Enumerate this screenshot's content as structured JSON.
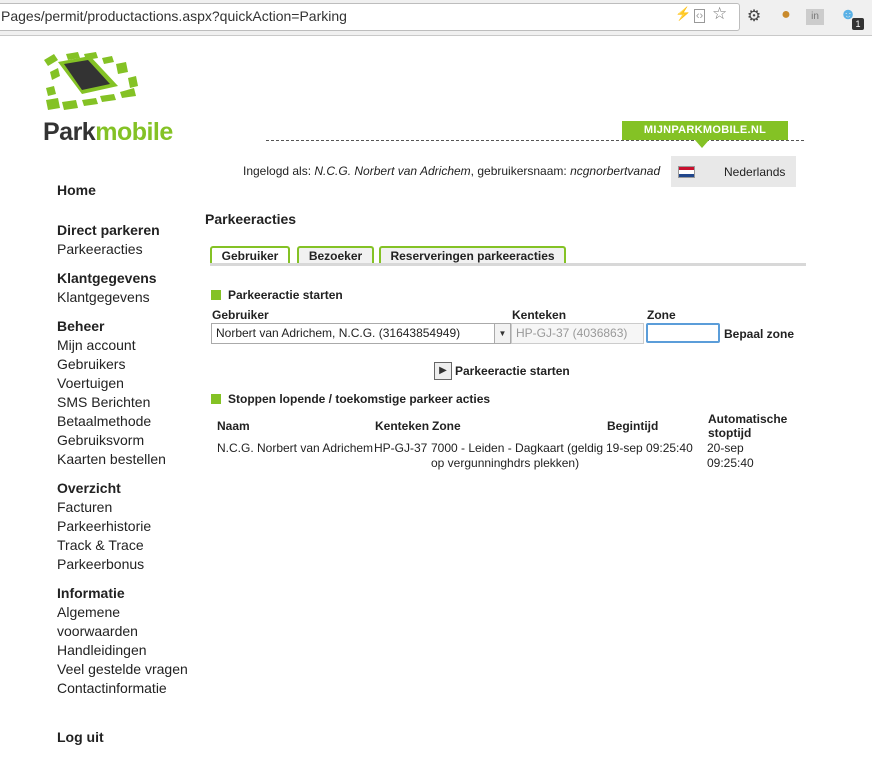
{
  "browser": {
    "url": "Pages/permit/productactions.aspx?quickAction=Parking",
    "badge": "1"
  },
  "header": {
    "brand_dark": "Park",
    "brand_green": "mobile",
    "portal_tab": "MIJNPARKMOBILE.NL",
    "logged_prefix": "Ingelogd als: ",
    "logged_name": "N.C.G. Norbert van Adrichem",
    "logged_mid": ", gebruikersnaam: ",
    "logged_user": "ncgnorbertvanad",
    "language": "Nederlands"
  },
  "nav": {
    "home": "Home",
    "sections": [
      {
        "title": "Direct parkeren",
        "items": [
          "Parkeeracties"
        ]
      },
      {
        "title": "Klantgegevens",
        "items": [
          "Klantgegevens"
        ]
      },
      {
        "title": "Beheer",
        "items": [
          "Mijn account",
          "Gebruikers",
          "Voertuigen",
          "SMS Berichten",
          "Betaalmethode",
          "Gebruiksvorm",
          "Kaarten bestellen"
        ]
      },
      {
        "title": "Overzicht",
        "items": [
          "Facturen",
          "Parkeerhistorie",
          "Track & Trace",
          "Parkeerbonus"
        ]
      },
      {
        "title": "Informatie",
        "items": [
          "Algemene voorwaarden",
          "Handleidingen",
          "Veel gestelde vragen",
          "Contactinformatie"
        ]
      }
    ],
    "logout": "Log uit"
  },
  "main": {
    "title": "Parkeeracties",
    "tabs": [
      "Gebruiker",
      "Bezoeker",
      "Reserveringen parkeeracties"
    ],
    "start_section": {
      "title": "Parkeeractie starten",
      "label_user": "Gebruiker",
      "label_plate": "Kenteken",
      "label_zone": "Zone",
      "user_value": "Norbert van Adrichem, N.C.G. (31643854949)",
      "plate_value": "HP-GJ-37 (4036863)",
      "zone_value": "",
      "bepaal_zone": "Bepaal zone",
      "start_button": "Parkeeractie starten"
    },
    "stop_section": {
      "title": "Stoppen lopende / toekomstige parkeer acties",
      "headers": {
        "naam": "Naam",
        "kenteken": "Kenteken",
        "zone": "Zone",
        "begintijd": "Begintijd",
        "stoptijd_1": "Automatische",
        "stoptijd_2": "stoptijd"
      },
      "rows": [
        {
          "naam": "N.C.G. Norbert van Adrichem",
          "kenteken": "HP-GJ-37",
          "zone_1": "7000 - Leiden - Dagkaart (geldig",
          "zone_2": "op vergunninghdrs plekken)",
          "begintijd": "19-sep 09:25:40",
          "stoptijd_1": "20-sep",
          "stoptijd_2": "09:25:40"
        }
      ]
    }
  },
  "colors": {
    "accent": "#84c225",
    "text": "#222222",
    "focus": "#5b9dd9"
  }
}
